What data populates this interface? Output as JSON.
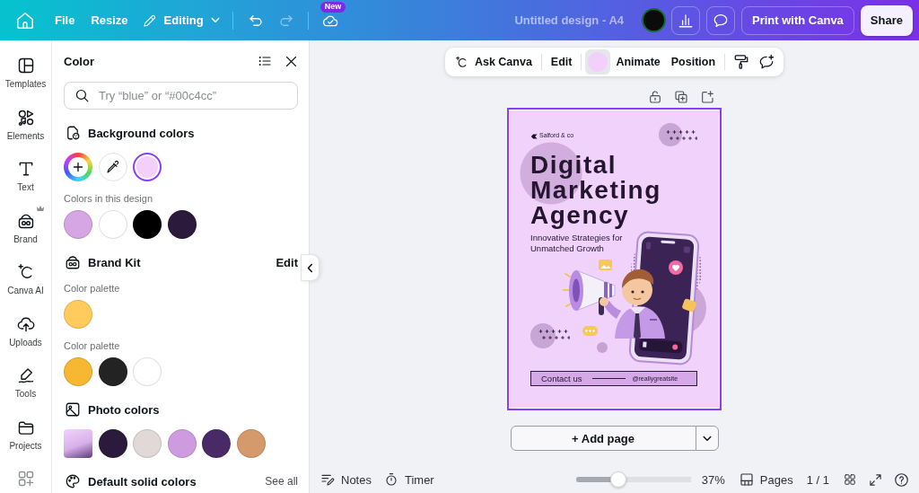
{
  "top_bar": {
    "menu": [
      "File",
      "Resize"
    ],
    "mode": "Editing",
    "history": [
      {
        "kind": "undo",
        "disabled": false
      },
      {
        "kind": "redo",
        "disabled": true
      }
    ],
    "save_badge": "New",
    "design_title": "Untitled design - A4",
    "print_button": "Print with Canva",
    "share_button": "Share"
  },
  "sidebar": {
    "items": [
      {
        "kind": "templates",
        "label": "Templates",
        "pro": false
      },
      {
        "kind": "elements",
        "label": "Elements",
        "pro": false
      },
      {
        "kind": "text",
        "label": "Text",
        "pro": false
      },
      {
        "kind": "brand",
        "label": "Brand",
        "pro": true
      },
      {
        "kind": "ai",
        "label": "Canva AI",
        "pro": false
      },
      {
        "kind": "uploads",
        "label": "Uploads",
        "pro": false
      },
      {
        "kind": "tools",
        "label": "Tools",
        "pro": false
      },
      {
        "kind": "projects",
        "label": "Projects",
        "pro": false
      },
      {
        "kind": "apps",
        "pro": false
      }
    ]
  },
  "color_panel": {
    "title": "Color",
    "search": {
      "placeholder": "Try “blue” or “#00c4cc”"
    },
    "sections": [
      {
        "kind": "background",
        "heading": "Background colors",
        "rows": [
          {
            "swatches": [
              {
                "kind": "add",
                "selected": false
              },
              {
                "kind": "picker",
                "selected": false
              },
              {
                "kind": "color",
                "color": "#f2d0fb",
                "selected": true
              }
            ]
          },
          {
            "label": "Colors in this design",
            "swatches": [
              {
                "kind": "color",
                "color": "#d5a6e3",
                "selected": false
              },
              {
                "kind": "color",
                "color": "#ffffff",
                "selected": false
              },
              {
                "kind": "color",
                "color": "#000000",
                "selected": false
              },
              {
                "kind": "color",
                "color": "#2b1a3b",
                "selected": false
              }
            ]
          }
        ]
      },
      {
        "kind": "brand",
        "heading": "Brand Kit",
        "action": "Edit",
        "rows": [
          {
            "label": "Color palette",
            "swatches": [
              {
                "kind": "color",
                "color": "#ffcb5c",
                "selected": false
              }
            ]
          },
          {
            "label": "Color palette",
            "swatches": [
              {
                "kind": "color",
                "color": "#f6b833",
                "selected": false
              },
              {
                "kind": "color",
                "color": "#232323",
                "selected": false
              },
              {
                "kind": "color",
                "color": "#ffffff",
                "selected": false
              }
            ]
          }
        ]
      },
      {
        "kind": "photo",
        "heading": "Photo colors",
        "rows": [
          {
            "swatches": [
              {
                "kind": "photo",
                "selected": false
              },
              {
                "kind": "color",
                "color": "#2b1a3b",
                "selected": false
              },
              {
                "kind": "color",
                "color": "#e2d8d8",
                "selected": false
              },
              {
                "kind": "color",
                "color": "#cf9be0",
                "selected": false
              },
              {
                "kind": "color",
                "color": "#4a2a66",
                "selected": false
              },
              {
                "kind": "color",
                "color": "#d49a6b",
                "selected": false
              }
            ]
          }
        ]
      },
      {
        "kind": "default",
        "heading": "Default solid colors",
        "action": "See all"
      }
    ]
  },
  "canvas": {
    "toolbar": {
      "groups": [
        [
          {
            "kind": "ai",
            "label": "Ask Canva",
            "active": false
          }
        ],
        [
          {
            "kind": "text",
            "label": "Edit",
            "active": false
          }
        ],
        [
          {
            "kind": "swatch",
            "color": "#f2d0fb",
            "active": true
          },
          {
            "kind": "text",
            "label": "Animate",
            "active": false
          },
          {
            "kind": "text",
            "label": "Position",
            "active": false
          }
        ],
        [
          {
            "kind": "painter",
            "active": false
          },
          {
            "kind": "comment",
            "active": false
          }
        ]
      ]
    },
    "page": {
      "selected": true,
      "brand": "Salford & co",
      "headline": "Digital Marketing Agency",
      "tagline": "Innovative Strategies for Unmatched Growth",
      "contact_label": "Contact us",
      "contact_site": "@reallygreatsite"
    },
    "add_page": {
      "label": "+ Add page"
    }
  },
  "bottom_bar": {
    "notes": "Notes",
    "timer": "Timer",
    "zoom": {
      "level": 0.35,
      "reading": "37%"
    },
    "pages": "Pages",
    "page_count": "1 / 1"
  }
}
